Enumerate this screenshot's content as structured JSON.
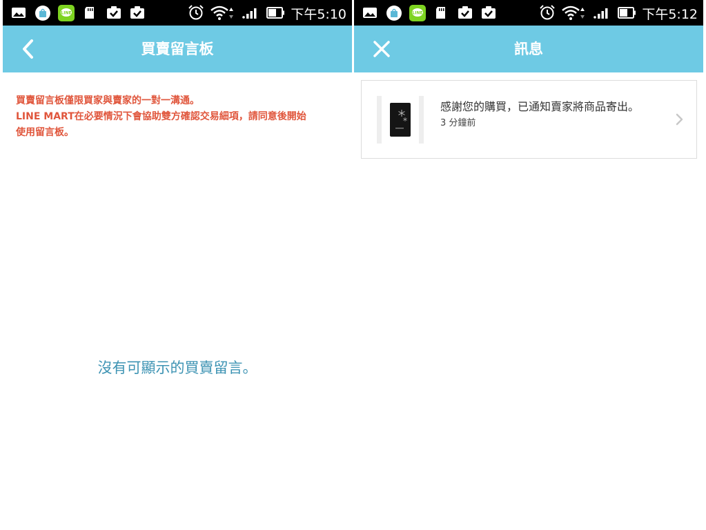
{
  "left": {
    "status_time": "下午5:10",
    "title": "買賣留言板",
    "notice_lines": [
      "買賣留言板僅限買家與賣家的一對一溝通。",
      "LINE MART在必要情況下會協助雙方確認交易細項，請同意後開始",
      "使用留言板。"
    ],
    "empty_message": "沒有可顯示的買賣留言。"
  },
  "right": {
    "status_time": "下午5:12",
    "title": "訊息",
    "message": {
      "text": "感謝您的購買，已通知賣家將商品寄出。",
      "time": "3 分鐘前"
    }
  },
  "status_icons": [
    "photo-icon",
    "shopping-bag-icon",
    "line-icon",
    "sd-card-icon",
    "clipboard-check-icon",
    "clipboard-check-icon",
    "alarm-icon",
    "wifi-icon",
    "signal-icon",
    "battery-icon"
  ],
  "colors": {
    "appbar": "#6ecae4",
    "notice_text": "#e0563c",
    "empty_text": "#3d93b3",
    "statusbar": "#000000"
  }
}
